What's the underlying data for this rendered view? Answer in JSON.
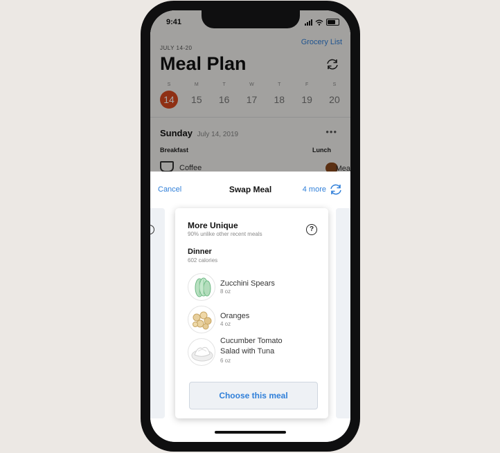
{
  "status_bar": {
    "time": "9:41"
  },
  "background": {
    "date_range": "JULY 14-20",
    "grocery_link": "Grocery List",
    "title": "Meal Plan",
    "week": [
      {
        "dow": "S",
        "num": "14"
      },
      {
        "dow": "M",
        "num": "15"
      },
      {
        "dow": "T",
        "num": "16"
      },
      {
        "dow": "W",
        "num": "17"
      },
      {
        "dow": "T",
        "num": "18"
      },
      {
        "dow": "F",
        "num": "19"
      },
      {
        "dow": "S",
        "num": "20"
      }
    ],
    "selected_day": "14",
    "day_label": "Sunday",
    "day_date": "July 14, 2019",
    "breakfast_label": "Breakfast",
    "lunch_label": "Lunch",
    "breakfast_item": "Coffee",
    "lunch_item": "Mea"
  },
  "sheet": {
    "cancel": "Cancel",
    "title": "Swap Meal",
    "more": "4 more",
    "card": {
      "heading": "More Unique",
      "subheading": "90% unlike other recent meals",
      "meal": "Dinner",
      "calories": "602 calories",
      "items": [
        {
          "name": "Zucchini Spears",
          "qty": "8 oz",
          "icon": "zucchini-icon"
        },
        {
          "name": "Oranges",
          "qty": "4 oz",
          "icon": "oranges-icon"
        },
        {
          "name": "Cucumber Tomato Salad with Tuna",
          "qty": "6 oz",
          "icon": "salad-icon"
        }
      ],
      "cta": "Choose this meal"
    }
  },
  "colors": {
    "accent": "#2f7fd9",
    "selected_day": "#d94a1f"
  }
}
